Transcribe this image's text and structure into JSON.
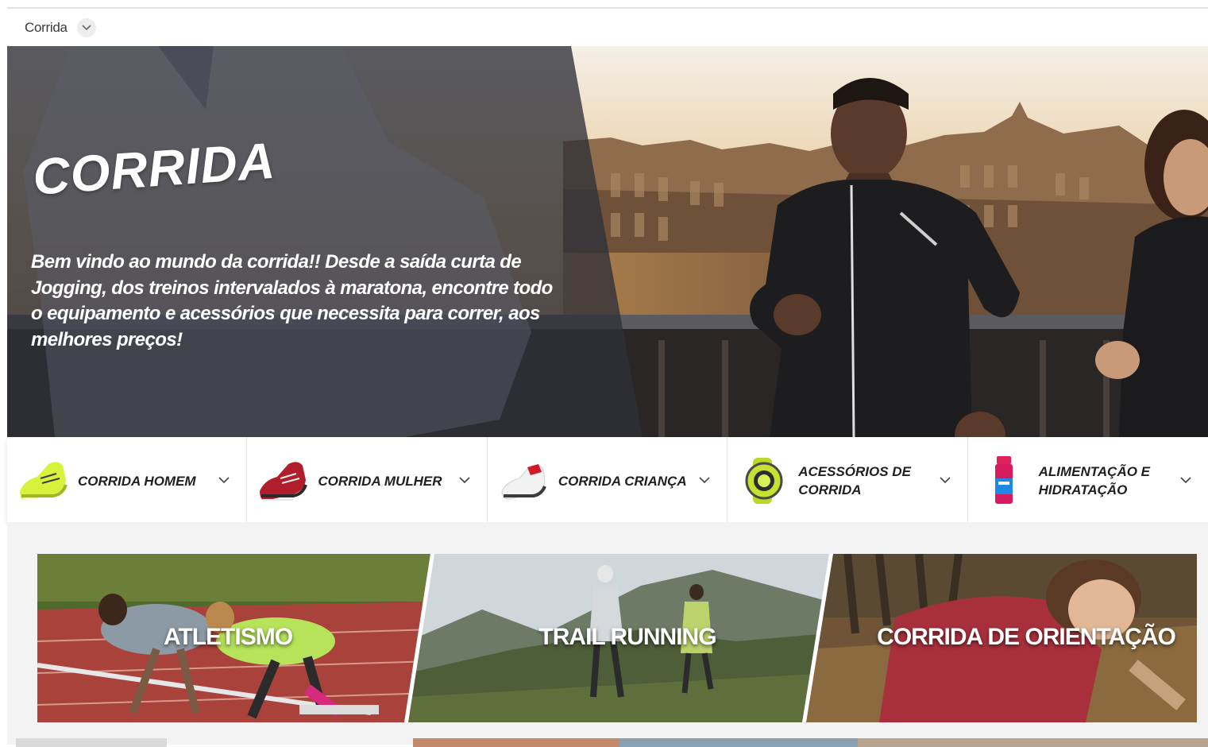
{
  "breadcrumb": {
    "label": "Corrida",
    "toggle_icon": "chevron-down-icon"
  },
  "hero": {
    "title": "CORRIDA",
    "text": "Bem vindo ao mundo da corrida!! Desde a saída curta de Jogging, dos treinos intervalados à maratona, encontre todo o equipamento e acessórios que necessita para correr, aos melhores preços!"
  },
  "categories": [
    {
      "label": "CORRIDA HOMEM",
      "icon": "running-shoe-yellow-icon"
    },
    {
      "label": "CORRIDA MULHER",
      "icon": "running-shoe-red-icon"
    },
    {
      "label": "CORRIDA CRIANÇA",
      "icon": "running-shoe-white-icon"
    },
    {
      "label": "ACESSÓRIOS DE CORRIDA",
      "icon": "sport-watch-icon"
    },
    {
      "label": "ALIMENTAÇÃO E HIDRATAÇÃO",
      "icon": "drink-bottle-icon"
    }
  ],
  "tiles": [
    {
      "label": "ATLETISMO"
    },
    {
      "label": "TRAIL RUNNING"
    },
    {
      "label": "CORRIDA DE ORIENTAÇÃO"
    }
  ],
  "colors": {
    "text_dark": "#1f1f1f",
    "hero_overlay": "#3b3d45",
    "bar_border": "#e5e5e5"
  }
}
